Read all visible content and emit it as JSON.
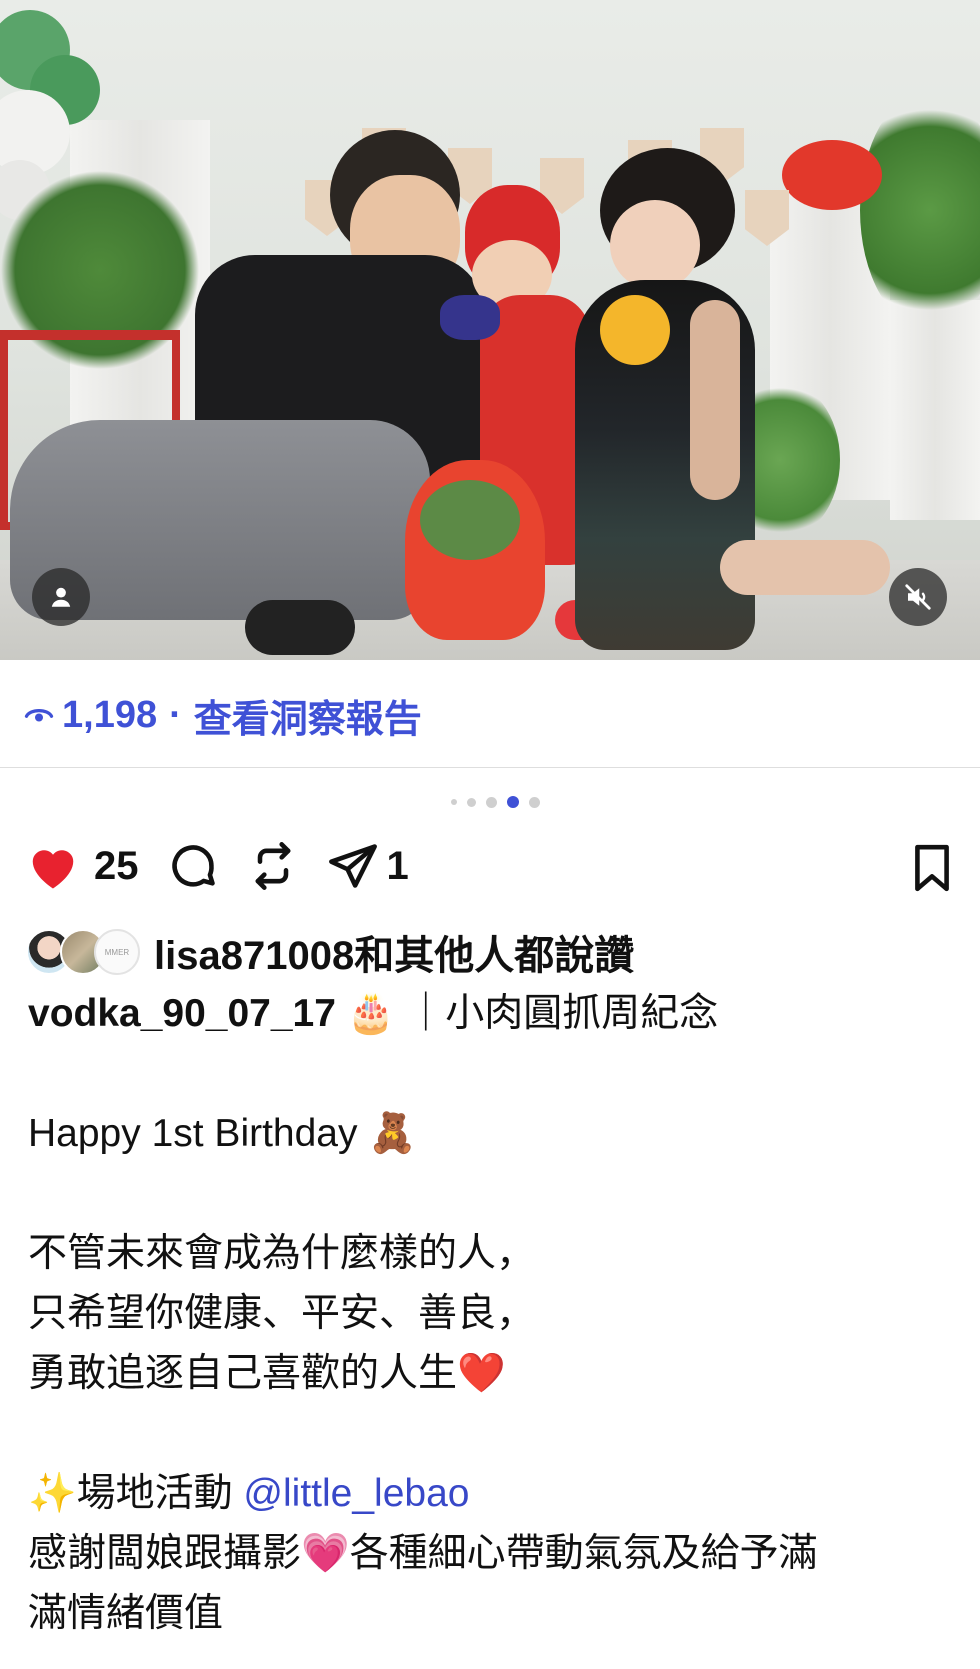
{
  "post": {
    "views_count": "1,198",
    "separator": "·",
    "insights_link": "查看洞察報告",
    "carousel": {
      "total": 5,
      "active_index": 3
    },
    "likes_count": "25",
    "shares_count": "1",
    "liked_by_user": "lisa871008",
    "liked_by_suffix": "和其他人都說讚",
    "caption": {
      "author": "vodka_90_07_17",
      "author_emoji": "🎂",
      "title": "｜小肉圓抓周紀念",
      "line_birthday": "Happy 1st Birthday",
      "bear_emoji": "🧸",
      "line_1": "不管未來會成為什麼樣的人，",
      "line_2": "只希望你健康、平安、善良，",
      "line_3": "勇敢追逐自己喜歡的人生",
      "heart_emoji": "❤️",
      "sparkles_emoji": "✨",
      "venue_label": "場地活動",
      "venue_mention": "@little_lebao",
      "thanks_1": "感謝闆娘跟攝影",
      "pink_heart_emoji": "💗",
      "thanks_2": "各種細心帶動氣氛及給予滿",
      "thanks_3": "滿情緒價值"
    },
    "liker_avatar_text": "MMER"
  },
  "colors": {
    "link_blue": "#3f51d6",
    "heart_red": "#e8222f",
    "dot_active": "#3f51d6"
  },
  "icons": [
    "eye-icon",
    "heart-icon",
    "comment-icon",
    "repost-icon",
    "share-icon",
    "bookmark-icon",
    "user-tag-icon",
    "mute-icon"
  ]
}
